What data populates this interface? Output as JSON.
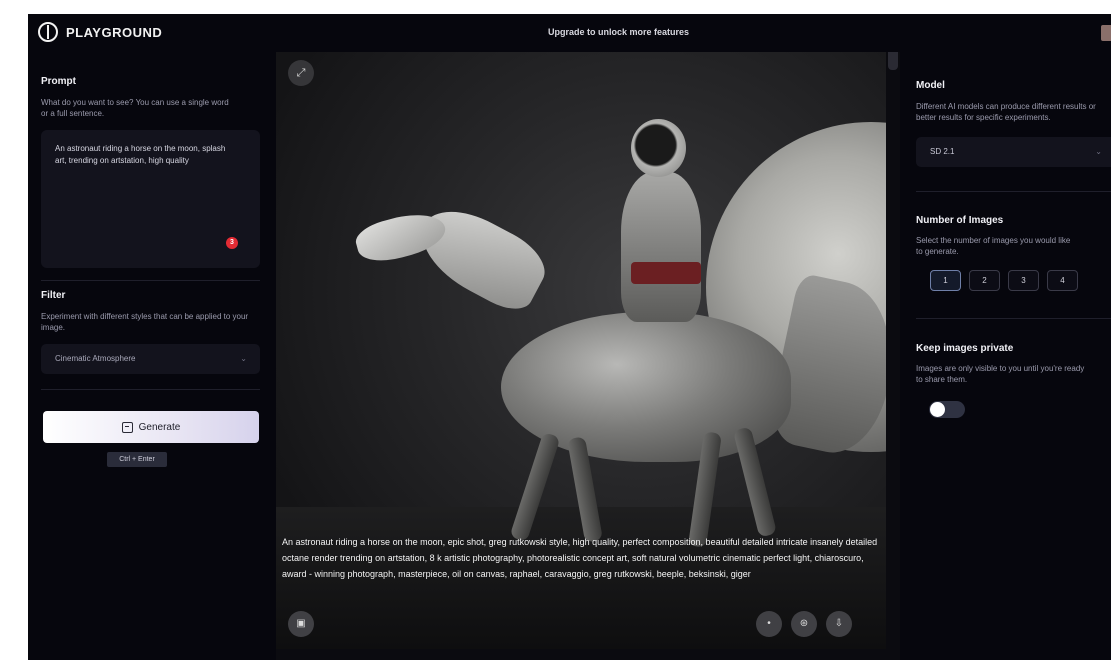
{
  "header": {
    "logo_text": "PLAYGROUND",
    "center_text": "Upgrade to unlock more features"
  },
  "left": {
    "prompt": {
      "title": "Prompt",
      "description": "What do you want to see? You can use a single word or a full sentence.",
      "text": "An astronaut riding a horse on the moon, splash art, trending on artstation, high quality",
      "badge": "3"
    },
    "filter": {
      "title": "Filter",
      "description": "Experiment with different styles that can be applied to your image.",
      "selected": "Cinematic Atmosphere"
    },
    "generate_label": "Generate",
    "shortcut": "Ctrl + Enter"
  },
  "center": {
    "caption": "An astronaut riding a horse on the moon, epic shot, greg rutkowski style, high quality, perfect composition, beautiful detailed intricate insanely detailed octane render trending on artstation, 8 k artistic photography, photorealistic concept art, soft natural volumetric cinematic perfect light, chiaroscuro, award - winning photograph, masterpiece, oil on canvas, raphael, caravaggio, greg rutkowski, beeple, beksinski, giger"
  },
  "right": {
    "model": {
      "title": "Model",
      "description": "Different AI models can produce different results or better results for specific experiments.",
      "selected": "SD 2.1"
    },
    "number": {
      "title": "Number of Images",
      "description": "Select the number of images you would like to generate.",
      "options": [
        "1",
        "2",
        "3",
        "4"
      ],
      "selected_index": 0
    },
    "privacy": {
      "title": "Keep images private",
      "description": "Images are only visible to you until you're ready to share them.",
      "enabled": false
    }
  },
  "colors": {
    "panel_bg": "#06060d",
    "accent_badge": "#e32b34"
  },
  "icons": {
    "expand": "expand-icon",
    "generate": "sparkle-icon",
    "info": "info-icon",
    "variations": "variations-icon",
    "download": "download-icon",
    "trash": "trash-icon"
  }
}
